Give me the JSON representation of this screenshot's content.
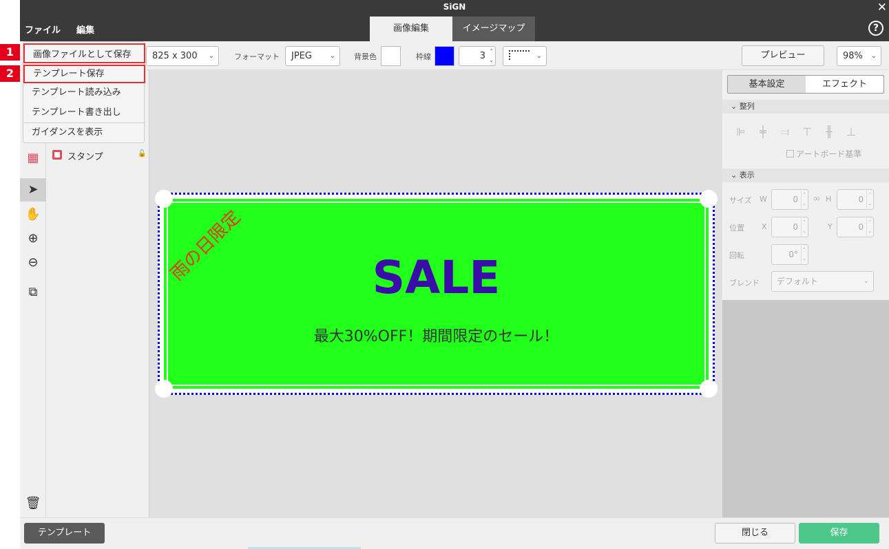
{
  "app": {
    "title": "SiGN",
    "close_glyph": "✕"
  },
  "menubar": {
    "file": "ファイル",
    "edit": "編集",
    "help_glyph": "?"
  },
  "tabs": [
    {
      "label": "画像編集",
      "active": true
    },
    {
      "label": "イメージマップ",
      "active": false
    }
  ],
  "toolbar": {
    "size": "825 x 300",
    "format_label": "フォーマット",
    "format": "JPEG",
    "bg_label": "背景色",
    "bg_color": "#ffffff",
    "border_label": "枠線",
    "border_color": "#0000ff",
    "border_width": "3",
    "preview": "プレビュー",
    "zoom": "98%"
  },
  "file_menu": {
    "items": [
      {
        "label": "画像ファイルとして保存",
        "marker": "1"
      },
      {
        "label": "テンプレート保存",
        "marker": "2"
      },
      {
        "label": "テンプレート読み込み"
      },
      {
        "label": "テンプレート書き出し"
      },
      {
        "label": "ガイダンスを表示"
      }
    ]
  },
  "layers": [
    {
      "label": "スタンプ"
    }
  ],
  "canvas": {
    "diagonal": "雨の日限定",
    "headline": "SALE",
    "subline": "最大30%OFF！期間限定のセール！",
    "banner_color": "#22ff1a",
    "headline_color": "#3a0ca8",
    "diagonal_color": "#e3371e"
  },
  "right_panel": {
    "tabs": [
      "基本設定",
      "エフェクト"
    ],
    "align_section": "整列",
    "artboard_check": "アートボード基準",
    "display_section": "表示",
    "size_label": "サイズ",
    "w_label": "W",
    "h_label": "H",
    "w_value": "0",
    "h_value": "0",
    "pos_label": "位置",
    "x_label": "X",
    "y_label": "Y",
    "x_value": "0",
    "y_value": "0",
    "rotate_label": "回転",
    "rotate_value": "0°",
    "blend_label": "ブレンド",
    "blend_value": "デフォルト"
  },
  "bottom": {
    "template": "テンプレート",
    "close": "閉じる",
    "save": "保存",
    "save_color": "#4dc88a"
  }
}
